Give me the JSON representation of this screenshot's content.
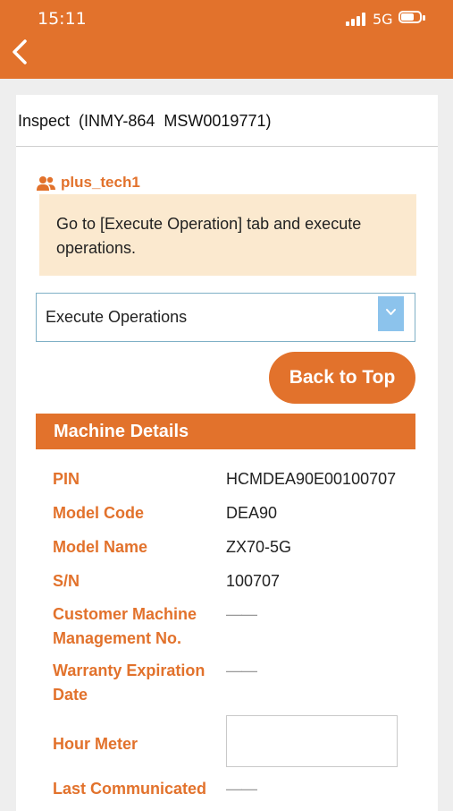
{
  "status_bar": {
    "time": "15:11",
    "network": "5G"
  },
  "header": {
    "title": "Inspect  (INMY-864  MSW0019771)"
  },
  "user": {
    "name": "plus_tech1"
  },
  "notice": {
    "text": "Go to [Execute Operation] tab and execute operations."
  },
  "operation_select": {
    "value": "Execute Operations"
  },
  "back_to_top_label": "Back to Top",
  "machine_details": {
    "title": "Machine Details",
    "fields": [
      {
        "label": "PIN",
        "value": "HCMDEA90E00100707"
      },
      {
        "label": "Model Code",
        "value": "DEA90"
      },
      {
        "label": "Model Name",
        "value": "ZX70-5G"
      },
      {
        "label": "S/N",
        "value": "100707"
      },
      {
        "label": "Customer Machine Management No.",
        "value": "——"
      },
      {
        "label": "Warranty Expiration Date",
        "value": "——"
      },
      {
        "label": "Hour Meter",
        "value": ""
      },
      {
        "label": "Last Communicated",
        "value": "——"
      }
    ]
  },
  "colors": {
    "accent": "#e2722c",
    "notice_bg": "#fbe9cf",
    "select_arrow": "#8cc3ec"
  }
}
